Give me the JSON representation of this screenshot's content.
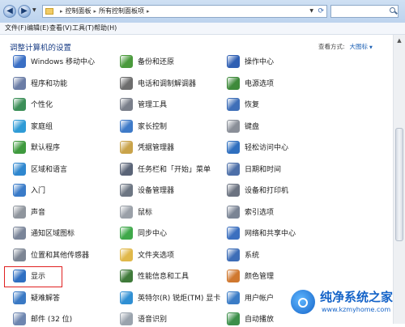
{
  "titlebar": {
    "breadcrumb": [
      "控制面板",
      "所有控制面板项"
    ]
  },
  "menu": [
    "文件(F)",
    "编辑(E)",
    "查看(V)",
    "工具(T)",
    "帮助(H)"
  ],
  "content": {
    "heading": "调整计算机的设置",
    "view_by_label": "查看方式:",
    "view_by_value": "大图标"
  },
  "items": [
    {
      "label": "Windows 移动中心",
      "icon": "mobility-center-icon",
      "color": "#3a6fc4"
    },
    {
      "label": "备份和还原",
      "icon": "backup-restore-icon",
      "color": "#4a9a3c"
    },
    {
      "label": "操作中心",
      "icon": "action-center-flag-icon",
      "color": "#2f5fb3"
    },
    {
      "label": "程序和功能",
      "icon": "programs-features-icon",
      "color": "#6b7da6"
    },
    {
      "label": "电话和调制解调器",
      "icon": "phone-modem-icon",
      "color": "#6d6d6d"
    },
    {
      "label": "电源选项",
      "icon": "power-options-icon",
      "color": "#3e8a3a"
    },
    {
      "label": "个性化",
      "icon": "personalization-icon",
      "color": "#3c8f58"
    },
    {
      "label": "管理工具",
      "icon": "admin-tools-icon",
      "color": "#7a7f8a"
    },
    {
      "label": "恢复",
      "icon": "recovery-icon",
      "color": "#3f6fb8"
    },
    {
      "label": "家庭组",
      "icon": "homegroup-icon",
      "color": "#2f9bd6"
    },
    {
      "label": "家长控制",
      "icon": "parental-controls-icon",
      "color": "#3e7ac8"
    },
    {
      "label": "键盘",
      "icon": "keyboard-icon",
      "color": "#8a8f98"
    },
    {
      "label": "默认程序",
      "icon": "default-programs-icon",
      "color": "#3f9a3e"
    },
    {
      "label": "凭据管理器",
      "icon": "credential-manager-icon",
      "color": "#c9a34a"
    },
    {
      "label": "轻松访问中心",
      "icon": "ease-of-access-icon",
      "color": "#2f6fbf"
    },
    {
      "label": "区域和语言",
      "icon": "region-language-icon",
      "color": "#2f87cf"
    },
    {
      "label": "任务栏和「开始」菜单",
      "icon": "taskbar-start-menu-icon",
      "color": "#5a6477"
    },
    {
      "label": "日期和时间",
      "icon": "date-time-icon",
      "color": "#4d6fa8"
    },
    {
      "label": "入门",
      "icon": "getting-started-icon",
      "color": "#3a7bc8"
    },
    {
      "label": "设备管理器",
      "icon": "device-manager-icon",
      "color": "#6d7683"
    },
    {
      "label": "设备和打印机",
      "icon": "devices-printers-icon",
      "color": "#6c7381"
    },
    {
      "label": "声音",
      "icon": "sound-icon",
      "color": "#8f959d"
    },
    {
      "label": "鼠标",
      "icon": "mouse-icon",
      "color": "#9aa0a8"
    },
    {
      "label": "索引选项",
      "icon": "indexing-options-icon",
      "color": "#7a8494"
    },
    {
      "label": "通知区域图标",
      "icon": "notification-area-icon",
      "color": "#7a8599"
    },
    {
      "label": "同步中心",
      "icon": "sync-center-icon",
      "color": "#3fa84a"
    },
    {
      "label": "网络和共享中心",
      "icon": "network-sharing-icon",
      "color": "#3b6fbf"
    },
    {
      "label": "位置和其他传感器",
      "icon": "location-sensors-icon",
      "color": "#7c8593"
    },
    {
      "label": "文件夹选项",
      "icon": "folder-options-icon",
      "color": "#e0b84a"
    },
    {
      "label": "系统",
      "icon": "system-icon",
      "color": "#3d6db7"
    },
    {
      "label": "显示",
      "icon": "display-icon",
      "color": "#2f6fc2"
    },
    {
      "label": "性能信息和工具",
      "icon": "performance-icon",
      "color": "#3f7a3a"
    },
    {
      "label": "颜色管理",
      "icon": "color-management-icon",
      "color": "#d0782f"
    },
    {
      "label": "疑难解答",
      "icon": "troubleshooting-icon",
      "color": "#3a79c4"
    },
    {
      "label": "英特尔(R) 锐炬(TM) 显卡",
      "icon": "intel-graphics-icon",
      "color": "#2f8fd3"
    },
    {
      "label": "用户帐户",
      "icon": "user-accounts-icon",
      "color": "#3b7cc6"
    },
    {
      "label": "邮件 (32 位)",
      "icon": "mail-icon",
      "color": "#6e86b0"
    },
    {
      "label": "语音识别",
      "icon": "speech-recognition-icon",
      "color": "#9aa3ad"
    },
    {
      "label": "自动播放",
      "icon": "autoplay-icon",
      "color": "#3c8f4a"
    }
  ],
  "watermark": {
    "title": "纯净系统之家",
    "url": "www.kzmyhome.com"
  }
}
